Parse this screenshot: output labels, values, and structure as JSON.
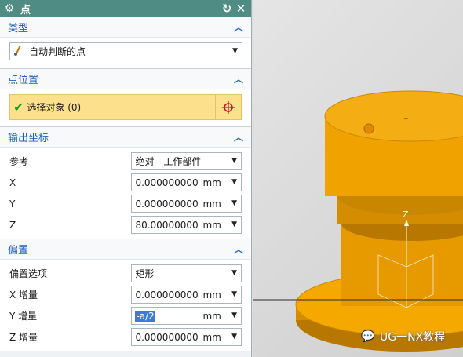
{
  "dialog": {
    "title": "点",
    "sections": {
      "type": {
        "title": "类型",
        "selected": "自动判断的点"
      },
      "point_location": {
        "title": "点位置",
        "select_label": "选择对象 (0)"
      },
      "output_coords": {
        "title": "输出坐标",
        "reference_label": "参考",
        "reference_value": "绝对 - 工作部件",
        "fields": [
          {
            "label": "X",
            "value": "0.000000000",
            "unit": "mm"
          },
          {
            "label": "Y",
            "value": "0.000000000",
            "unit": "mm"
          },
          {
            "label": "Z",
            "value": "80.00000000",
            "unit": "mm"
          }
        ]
      },
      "offset": {
        "title": "偏置",
        "option_label": "偏置选项",
        "option_value": "矩形",
        "fields": [
          {
            "label": "X 增量",
            "value": "0.000000000",
            "unit": "mm"
          },
          {
            "label": "Y 增量",
            "value": "-a/2",
            "unit": "mm"
          },
          {
            "label": "Z 增量",
            "value": "0.000000000",
            "unit": "mm"
          }
        ]
      }
    }
  },
  "viewport": {
    "axis_label": "Z",
    "watermark": "UG一NX教程"
  },
  "colors": {
    "title_bar": "#4f8d84",
    "section_title": "#1f5fbf",
    "highlight": "#fde08c",
    "model": "#f5a800"
  }
}
